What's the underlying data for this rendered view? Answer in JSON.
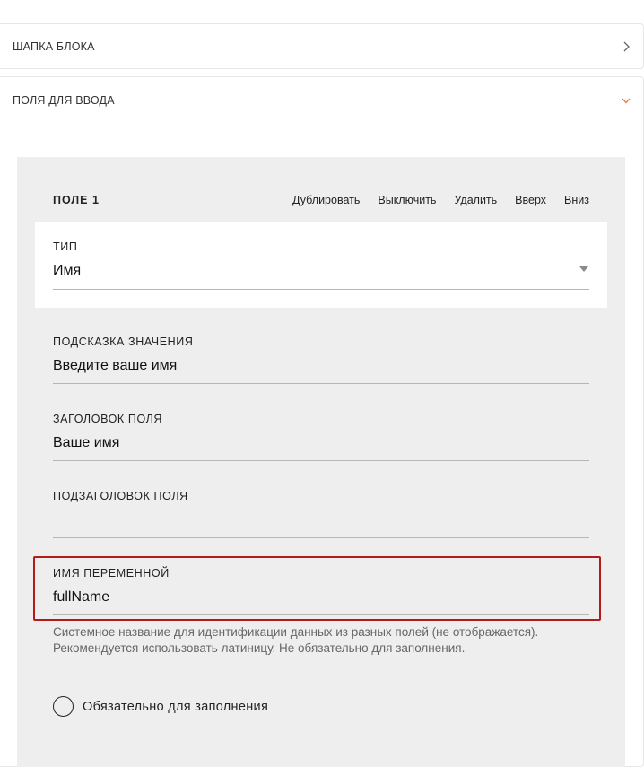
{
  "panels": [
    {
      "title": "ШАПКА БЛОКА",
      "state": "collapsed"
    },
    {
      "title": "ПОЛЯ ДЛЯ ВВОДА",
      "state": "expanded"
    }
  ],
  "field": {
    "title": "ПОЛЕ 1",
    "actions": [
      "Дублировать",
      "Выключить",
      "Удалить",
      "Вверх",
      "Вниз"
    ],
    "type_label": "ТИП",
    "type_value": "Имя",
    "placeholder_label": "ПОДСКАЗКА ЗНАЧЕНИЯ",
    "placeholder_value": "Введите ваше имя",
    "heading_label": "ЗАГОЛОВОК ПОЛЯ",
    "heading_value": "Ваше имя",
    "subheading_label": "ПОДЗАГОЛОВОК ПОЛЯ",
    "subheading_value": "",
    "variable_label": "ИМЯ ПЕРЕМЕННОЙ",
    "variable_value": "fullName",
    "variable_hint": "Системное название для идентификации данных из разных полей (не отображается). Рекомендуется использовать латиницу. Не обязательно для заполнения.",
    "required_label": "Обязательно для заполнения",
    "required_checked": false
  },
  "colors": {
    "accent_chevron": "#e07a3a",
    "highlight_border": "#b31b1b",
    "card_bg": "#eeeeee"
  },
  "icons": {
    "collapsed_chevron": "chevron-right-icon",
    "expanded_chevron": "chevron-down-icon",
    "type_dropdown": "caret-down-icon"
  }
}
